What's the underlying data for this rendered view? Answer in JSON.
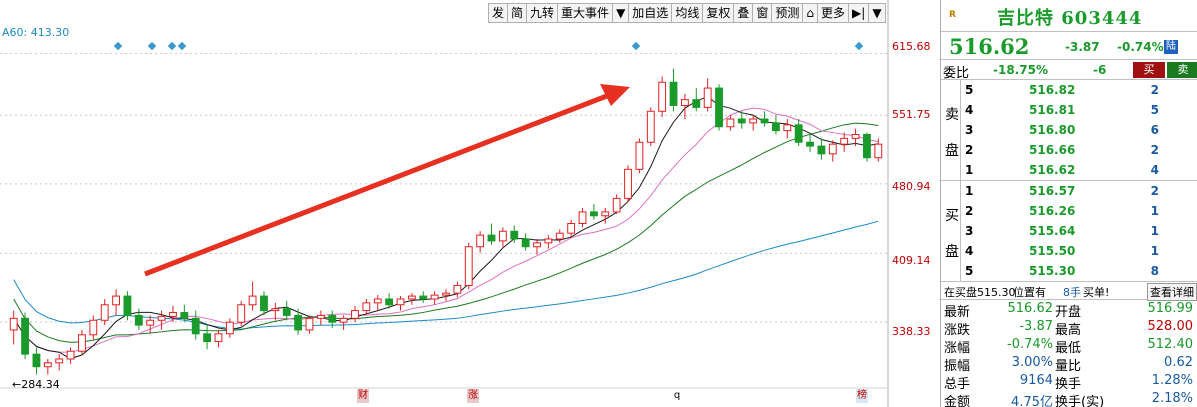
{
  "toolbar": [
    "发",
    "简",
    "九转",
    "重大事件",
    "▼",
    "加自选",
    "均线",
    "复权",
    "叠",
    "窗",
    "预测",
    "⌂",
    "更多",
    "▶|",
    "▼"
  ],
  "ma_label": "A60: 413.30",
  "price_axis": [
    "615.68",
    "551.75",
    "480.94",
    "409.14",
    "338.33"
  ],
  "low_label": "←284.34",
  "markers": [
    {
      "text": "财",
      "style": "red"
    },
    {
      "text": "涨",
      "style": "red"
    },
    {
      "text": "q",
      "style": "none"
    },
    {
      "text": "榜",
      "style": "blue"
    }
  ],
  "colors": {
    "up": "#e02020",
    "down": "#1a9a2a",
    "ma5": "#1a1a1a",
    "ma10": "#e070c0",
    "ma20": "#1a7a20",
    "ma60": "#1a8bc7",
    "arrow": "#e83020"
  },
  "chart_data": {
    "type": "candlestick",
    "ylim": [
      270,
      640
    ],
    "y_ticks": [
      615.68,
      551.75,
      480.94,
      409.14,
      338.33
    ],
    "low_annotation": 284.34,
    "ohlc": [
      [
        330,
        350,
        315,
        342
      ],
      [
        342,
        348,
        300,
        305
      ],
      [
        305,
        312,
        284,
        292
      ],
      [
        292,
        300,
        284,
        296
      ],
      [
        296,
        305,
        288,
        300
      ],
      [
        300,
        312,
        295,
        308
      ],
      [
        308,
        330,
        305,
        325
      ],
      [
        325,
        345,
        320,
        340
      ],
      [
        340,
        362,
        335,
        356
      ],
      [
        356,
        372,
        345,
        365
      ],
      [
        365,
        370,
        340,
        345
      ],
      [
        345,
        352,
        330,
        335
      ],
      [
        335,
        345,
        326,
        340
      ],
      [
        340,
        350,
        330,
        344
      ],
      [
        344,
        355,
        338,
        348
      ],
      [
        348,
        356,
        338,
        342
      ],
      [
        342,
        350,
        320,
        326
      ],
      [
        326,
        336,
        310,
        318
      ],
      [
        318,
        330,
        312,
        326
      ],
      [
        326,
        342,
        322,
        338
      ],
      [
        338,
        360,
        334,
        356
      ],
      [
        356,
        380,
        350,
        365
      ],
      [
        365,
        370,
        345,
        350
      ],
      [
        350,
        358,
        340,
        352
      ],
      [
        352,
        360,
        340,
        345
      ],
      [
        345,
        352,
        325,
        330
      ],
      [
        330,
        345,
        326,
        342
      ],
      [
        342,
        350,
        335,
        345
      ],
      [
        345,
        350,
        332,
        338
      ],
      [
        338,
        345,
        330,
        342
      ],
      [
        342,
        355,
        338,
        350
      ],
      [
        350,
        362,
        346,
        358
      ],
      [
        358,
        366,
        350,
        362
      ],
      [
        362,
        368,
        352,
        356
      ],
      [
        356,
        365,
        350,
        362
      ],
      [
        362,
        368,
        356,
        365
      ],
      [
        365,
        370,
        358,
        362
      ],
      [
        362,
        370,
        356,
        366
      ],
      [
        366,
        372,
        360,
        368
      ],
      [
        368,
        380,
        364,
        376
      ],
      [
        376,
        420,
        372,
        416
      ],
      [
        416,
        432,
        410,
        428
      ],
      [
        428,
        440,
        418,
        422
      ],
      [
        422,
        436,
        416,
        432
      ],
      [
        432,
        438,
        420,
        424
      ],
      [
        424,
        430,
        412,
        416
      ],
      [
        416,
        424,
        408,
        420
      ],
      [
        420,
        428,
        414,
        424
      ],
      [
        424,
        434,
        420,
        430
      ],
      [
        430,
        444,
        426,
        440
      ],
      [
        440,
        456,
        436,
        452
      ],
      [
        452,
        460,
        444,
        448
      ],
      [
        448,
        456,
        440,
        452
      ],
      [
        452,
        470,
        450,
        466
      ],
      [
        466,
        500,
        462,
        496
      ],
      [
        496,
        528,
        492,
        524
      ],
      [
        524,
        560,
        520,
        556
      ],
      [
        556,
        592,
        550,
        586
      ],
      [
        586,
        600,
        556,
        562
      ],
      [
        562,
        574,
        548,
        568
      ],
      [
        568,
        580,
        556,
        560
      ],
      [
        560,
        590,
        556,
        580
      ],
      [
        580,
        584,
        536,
        540
      ],
      [
        540,
        552,
        536,
        548
      ],
      [
        548,
        556,
        538,
        544
      ],
      [
        544,
        552,
        536,
        548
      ],
      [
        548,
        556,
        540,
        544
      ],
      [
        544,
        552,
        532,
        536
      ],
      [
        536,
        548,
        528,
        542
      ],
      [
        542,
        548,
        520,
        524
      ],
      [
        524,
        532,
        514,
        520
      ],
      [
        520,
        528,
        506,
        512
      ],
      [
        512,
        526,
        504,
        522
      ],
      [
        522,
        534,
        514,
        528
      ],
      [
        528,
        538,
        520,
        532
      ],
      [
        532,
        534,
        504,
        508
      ],
      [
        508,
        528,
        504,
        522
      ]
    ]
  },
  "panel": {
    "name": "吉比特 603444",
    "r_icon": "R",
    "last": "516.62",
    "change": "-3.87",
    "pct": "-0.74%",
    "lu": "陆",
    "weibi_label": "委比",
    "weibi_pct": "-18.75%",
    "weibi_diff": "-6",
    "buy_btn": "买",
    "sell_btn": "卖",
    "sell_side": [
      "卖",
      "盘"
    ],
    "buy_side": [
      "买",
      "盘"
    ],
    "asks": [
      {
        "lv": "5",
        "px": "516.82",
        "vol": "2"
      },
      {
        "lv": "4",
        "px": "516.81",
        "vol": "5"
      },
      {
        "lv": "3",
        "px": "516.80",
        "vol": "6"
      },
      {
        "lv": "2",
        "px": "516.66",
        "vol": "2"
      },
      {
        "lv": "1",
        "px": "516.62",
        "vol": "4"
      }
    ],
    "bids": [
      {
        "lv": "1",
        "px": "516.57",
        "vol": "2"
      },
      {
        "lv": "2",
        "px": "516.26",
        "vol": "1"
      },
      {
        "lv": "3",
        "px": "515.64",
        "vol": "1"
      },
      {
        "lv": "4",
        "px": "515.50",
        "vol": "1"
      },
      {
        "lv": "5",
        "px": "515.30",
        "vol": "8"
      }
    ],
    "note": {
      "t1": "在买盘515.30",
      "t2": "位置有",
      "t3": "8手",
      "t4": "买单!",
      "t5": "查看详细"
    },
    "stats": [
      {
        "k1": "最新",
        "v1": "516.62",
        "c1": "g",
        "k2": "开盘",
        "v2": "516.99",
        "c2": "g"
      },
      {
        "k1": "涨跌",
        "v1": "-3.87",
        "c1": "g",
        "k2": "最高",
        "v2": "528.00",
        "c2": "rd"
      },
      {
        "k1": "涨幅",
        "v1": "-0.74%",
        "c1": "g",
        "k2": "最低",
        "v2": "512.40",
        "c2": "g"
      },
      {
        "k1": "振幅",
        "v1": "3.00%",
        "c1": "bl",
        "k2": "量比",
        "v2": "0.62",
        "c2": "bl"
      },
      {
        "k1": "总手",
        "v1": "9164",
        "c1": "bl",
        "k2": "换手",
        "v2": "1.28%",
        "c2": "bl"
      },
      {
        "k1": "金额",
        "v1": "4.75亿",
        "c1": "bl",
        "k2": "换手(实)",
        "v2": "2.18%",
        "c2": "bl"
      }
    ]
  }
}
